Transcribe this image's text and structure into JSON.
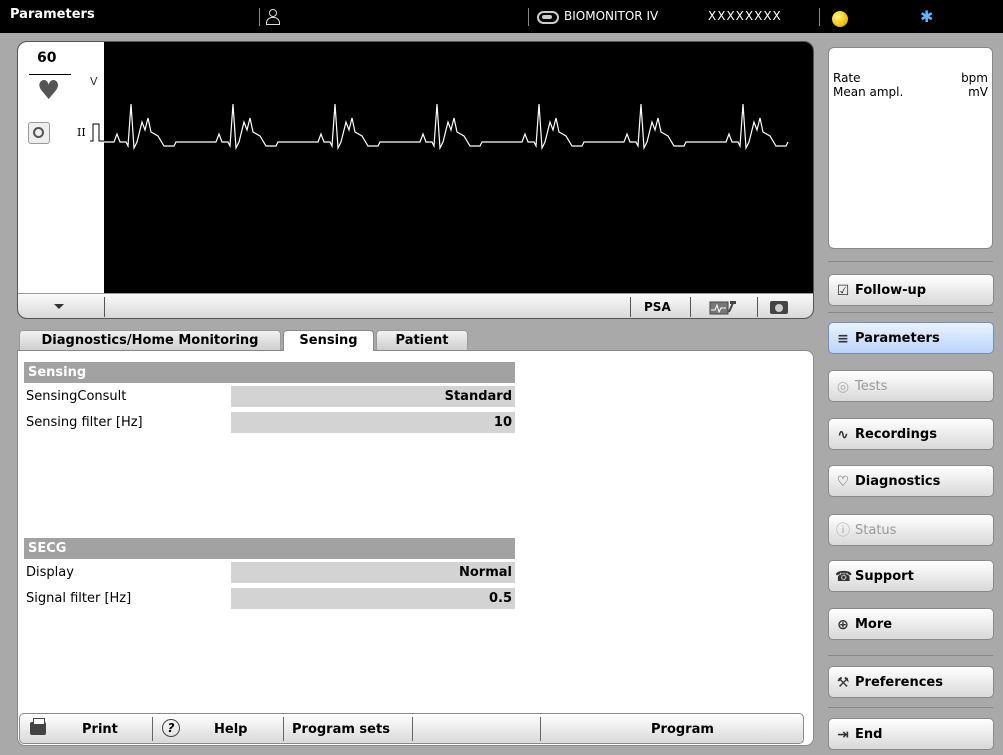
{
  "topbar": {
    "title": "Parameters",
    "device_name": "BIOMONITOR IV",
    "serial": "XXXXXXXX",
    "icons": [
      "person-icon",
      "device-icon",
      "battery-icon",
      "bluetooth-icon"
    ],
    "bluetooth_glyph": "✱"
  },
  "ecg": {
    "rate": "60",
    "heart_glyph": "♥",
    "channel_label": "V",
    "lead_label": "II",
    "psa_label": "PSA"
  },
  "measurements": {
    "rows": [
      {
        "label": "Rate",
        "unit": "bpm"
      },
      {
        "label": "Mean ampl.",
        "unit": "mV"
      }
    ]
  },
  "sidebar": {
    "buttons": [
      {
        "label": "Follow-up",
        "icon": "checklist-icon",
        "glyph": "☑"
      },
      {
        "label": "Parameters",
        "icon": "sliders-icon",
        "glyph": "≡"
      },
      {
        "label": "Tests",
        "icon": "tests-icon",
        "glyph": "◎"
      },
      {
        "label": "Recordings",
        "icon": "recordings-icon",
        "glyph": "∿"
      },
      {
        "label": "Diagnostics",
        "icon": "diagnostics-icon",
        "glyph": "♡"
      },
      {
        "label": "Status",
        "icon": "info-icon",
        "glyph": "ⓘ"
      },
      {
        "label": "Support",
        "icon": "support-icon",
        "glyph": "☎"
      },
      {
        "label": "More",
        "icon": "plus-icon",
        "glyph": "⊕"
      },
      {
        "label": "Preferences",
        "icon": "wrench-icon",
        "glyph": "⚒"
      },
      {
        "label": "End",
        "icon": "exit-icon",
        "glyph": "⇥"
      }
    ],
    "active": "Parameters",
    "disabled": [
      "Tests",
      "Status"
    ]
  },
  "tabs": [
    {
      "label": "Diagnostics/Home Monitoring"
    },
    {
      "label": "Sensing"
    },
    {
      "label": "Patient"
    }
  ],
  "active_tab": "Sensing",
  "sensing": {
    "header": "Sensing",
    "rows": [
      {
        "label": "SensingConsult",
        "value": "Standard"
      },
      {
        "label": "Sensing filter [Hz]",
        "value": "10"
      }
    ]
  },
  "secg": {
    "header": "SECG",
    "rows": [
      {
        "label": "Display",
        "value": "Normal"
      },
      {
        "label": "Signal filter [Hz]",
        "value": "0.5"
      }
    ]
  },
  "actions": {
    "print": "Print",
    "help": "Help",
    "program_sets": "Program sets",
    "program": "Program",
    "help_glyph": "?"
  },
  "colors": {
    "background": "#a9a9a9",
    "topbar": "#000000",
    "ecg_background": "#000000",
    "ecg_trace": "#ffffff",
    "section_header": "#a2a2a2",
    "value_cell": "#d3d3d3",
    "active_button": "#bcd4f8"
  }
}
